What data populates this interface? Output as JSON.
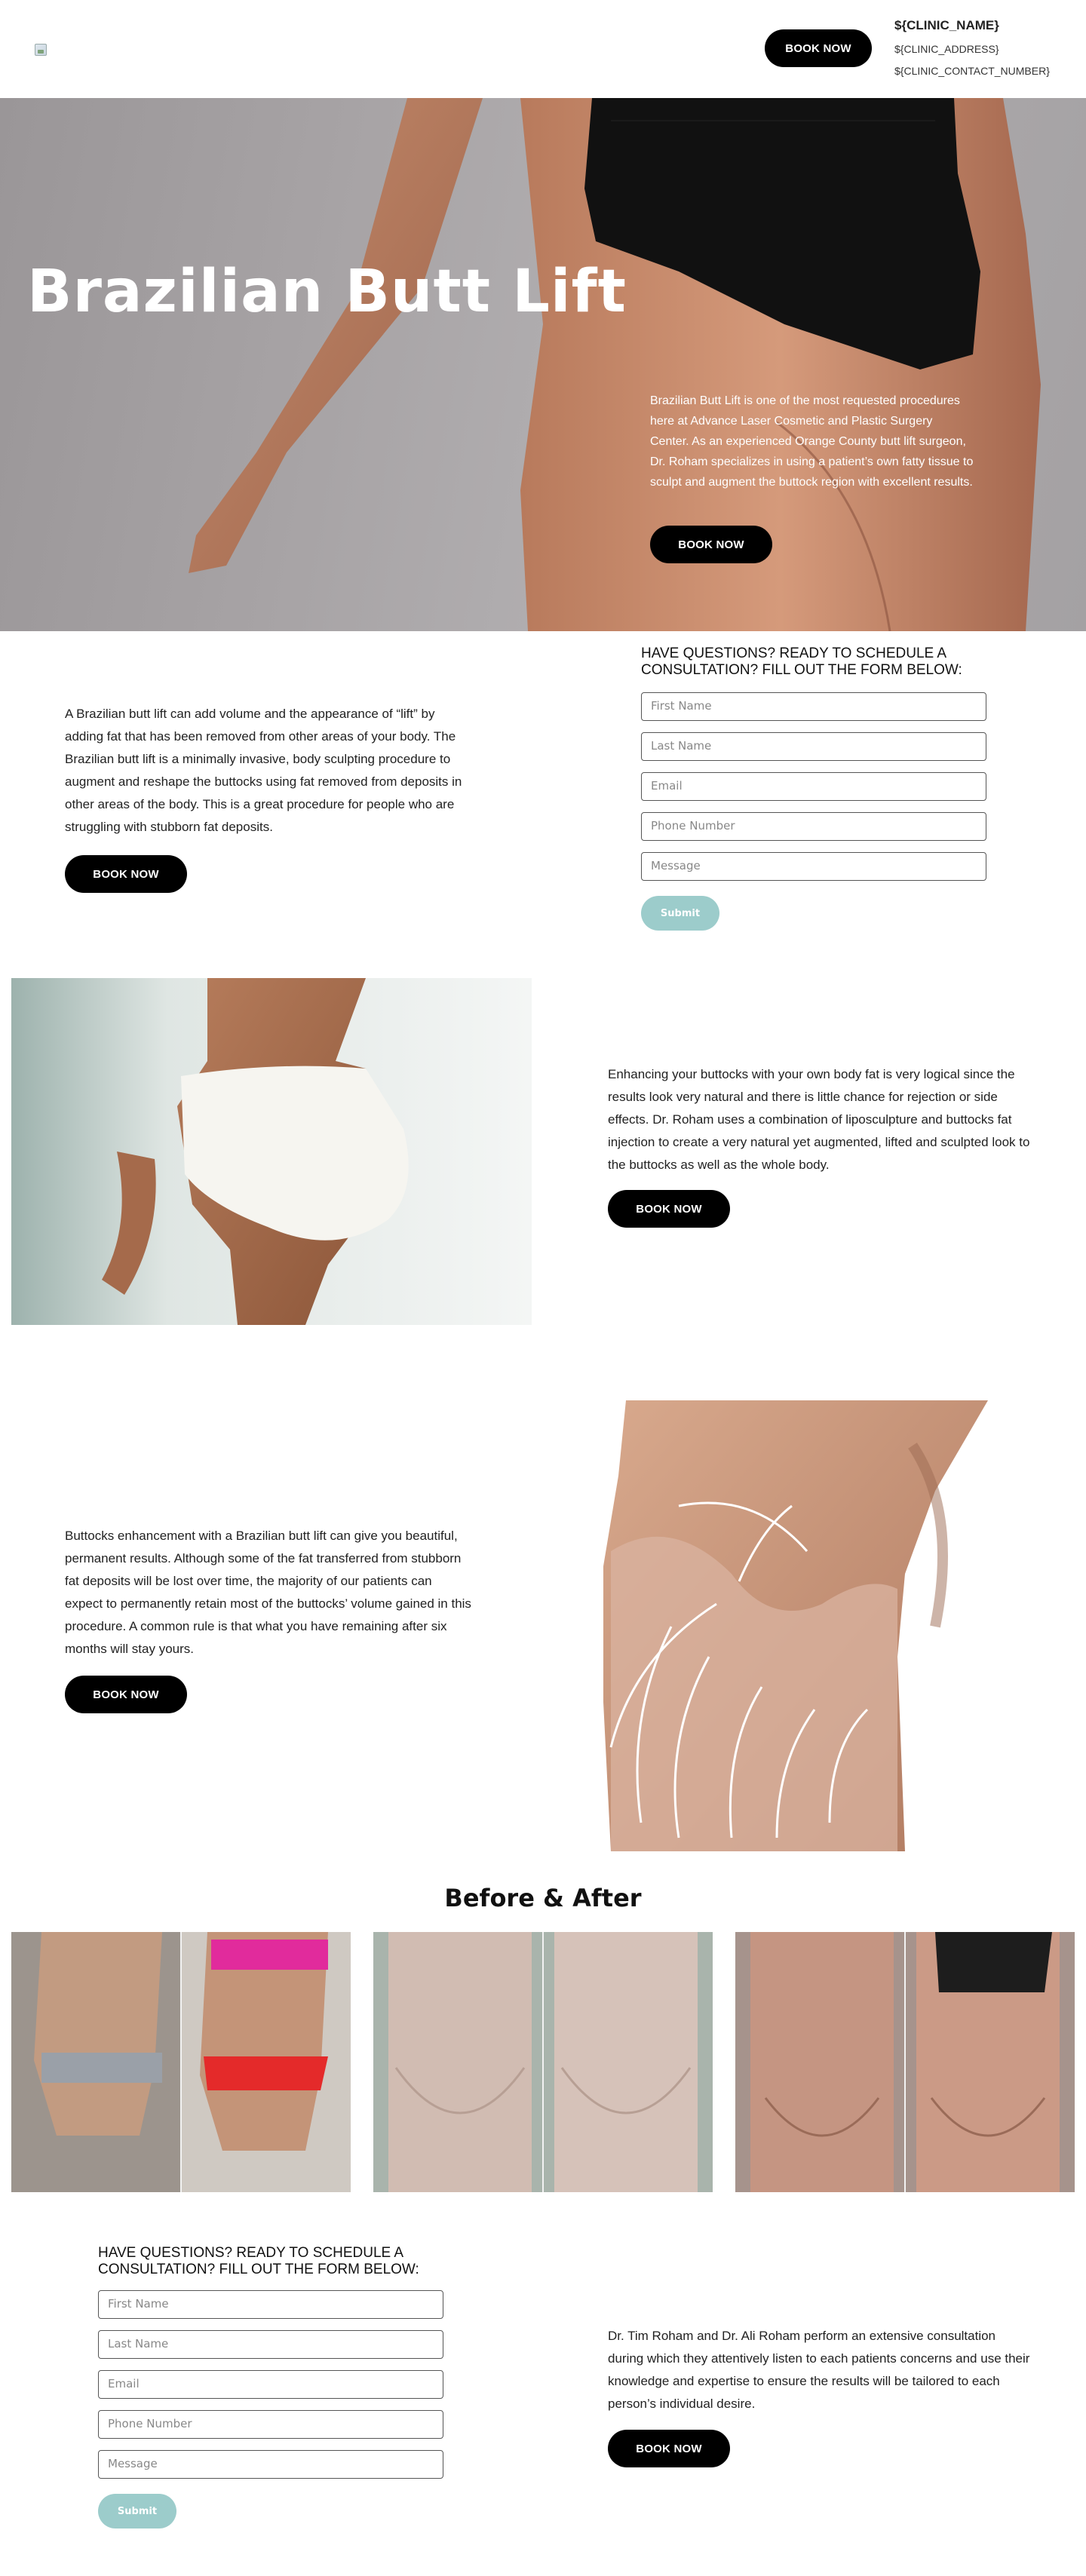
{
  "header": {
    "book_now": "BOOK NOW",
    "clinic_name": "${CLINIC_NAME}",
    "clinic_address": "${CLINIC_ADDRESS}",
    "clinic_contact": "${CLINIC_CONTACT_NUMBER}"
  },
  "hero": {
    "title": "Brazilian Butt Lift",
    "text": "Brazilian Butt Lift is one of the most requested procedures here at Advance Laser Cosmetic and Plastic Surgery Center. As an experienced Orange County butt lift surgeon, Dr. Roham specializes in using a patient’s own fatty tissue to sculpt and augment the buttock region with excellent results.",
    "book_now": "BOOK NOW"
  },
  "section1": {
    "text": "A Brazilian butt lift can add volume and the appearance of “lift” by adding fat that has been removed from other areas of your body. The Brazilian butt lift is a minimally invasive, body sculpting procedure to augment and reshape the buttocks using fat removed from deposits in other areas of the body. This is a great procedure for people who are struggling with stubborn fat deposits.",
    "book_now": "BOOK NOW"
  },
  "form1": {
    "title": "HAVE QUESTIONS? READY TO SCHEDULE A CONSULTATION? FILL OUT THE FORM BELOW:",
    "first_name": "First Name",
    "last_name": "Last Name",
    "email": "Email",
    "phone": "Phone Number",
    "message": "Message",
    "submit": "Submit"
  },
  "section2": {
    "text": "Enhancing your buttocks with your own body fat is very logical since the results look very natural and there is little chance for rejection or side effects. Dr. Roham uses a combination of liposculpture and buttocks fat injection to create a very natural yet augmented, lifted and sculpted look to the buttocks as well as the whole body.",
    "book_now": "BOOK NOW"
  },
  "section3": {
    "text": "Buttocks enhancement with a Brazilian butt lift can give you beautiful, permanent results. Although some of the fat transferred from stubborn fat deposits will be lost over time, the majority of our patients can expect to permanently retain most of the buttocks’ volume gained in this procedure. A common rule is that what you have remaining after six months will stay yours.",
    "book_now": "BOOK NOW"
  },
  "before_after": {
    "title": "Before & After"
  },
  "form2": {
    "title": "HAVE QUESTIONS? READY TO SCHEDULE A CONSULTATION? FILL OUT THE FORM BELOW:",
    "first_name": "First Name",
    "last_name": "Last Name",
    "email": "Email",
    "phone": "Phone Number",
    "message": "Message",
    "submit": "Submit"
  },
  "section4": {
    "text": "Dr. Tim Roham and Dr. Ali Roham perform an extensive consultation during which they attentively listen to each patients concerns and use their knowledge and expertise to ensure the results will be tailored to each person’s individual desire.",
    "book_now": "BOOK NOW"
  },
  "icons": {
    "logo": "broken-image-icon"
  }
}
